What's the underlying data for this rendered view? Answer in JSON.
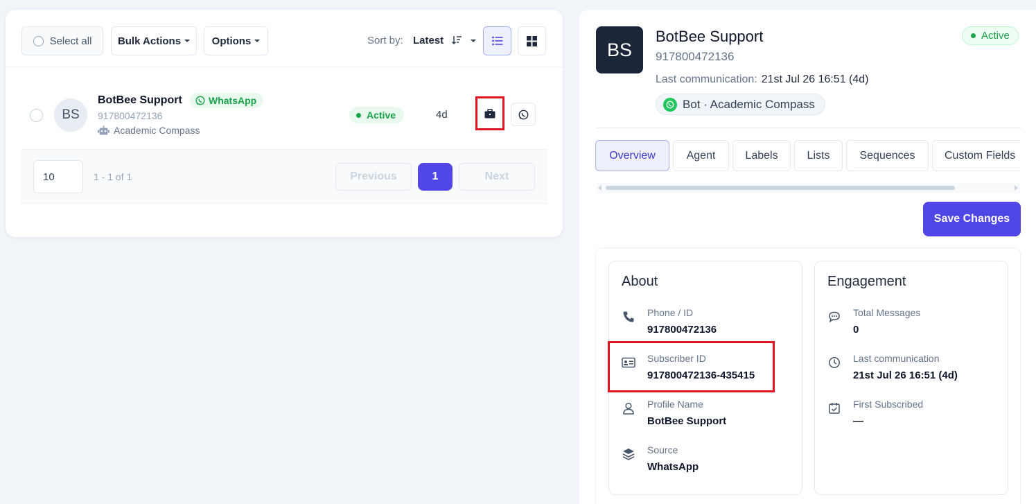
{
  "toolbar": {
    "select_all": "Select all",
    "bulk_actions": "Bulk Actions",
    "options": "Options",
    "sort_label": "Sort by:",
    "sort_value": "Latest"
  },
  "row": {
    "avatar_initials": "BS",
    "name": "BotBee Support",
    "channel": "WhatsApp",
    "phone": "917800472136",
    "bot": "Academic Compass",
    "status": "Active",
    "age": "4d"
  },
  "pagination": {
    "per_page": "10",
    "range": "1 - 1 of 1",
    "previous": "Previous",
    "current": "1",
    "next": "Next"
  },
  "contact": {
    "avatar_initials": "BS",
    "name": "BotBee Support",
    "phone": "917800472136",
    "last_comm_label": "Last communication:",
    "last_comm_value": "21st Jul 26 16:51 (4d)",
    "bot_pill": "Bot · Academic Compass",
    "status": "Active"
  },
  "tabs": [
    "Overview",
    "Agent",
    "Labels",
    "Lists",
    "Sequences",
    "Custom Fields"
  ],
  "save_label": "Save Changes",
  "about": {
    "title": "About",
    "fields": [
      {
        "label": "Phone / ID",
        "value": "917800472136",
        "icon": "phone-icon"
      },
      {
        "label": "Subscriber ID",
        "value": "917800472136-435415",
        "icon": "id-card-icon"
      },
      {
        "label": "Profile Name",
        "value": "BotBee Support",
        "icon": "user-icon"
      },
      {
        "label": "Source",
        "value": "WhatsApp",
        "icon": "layers-icon"
      }
    ]
  },
  "engagement": {
    "title": "Engagement",
    "fields": [
      {
        "label": "Total Messages",
        "value": "0",
        "icon": "chat-icon"
      },
      {
        "label": "Last communication",
        "value": "21st Jul 26 16:51 (4d)",
        "icon": "clock-icon"
      },
      {
        "label": "First Subscribed",
        "value": "—",
        "icon": "calendar-check-icon"
      }
    ]
  },
  "colors": {
    "accent": "#4f46e5",
    "active_green": "#16a34a",
    "highlight_red": "#e0141e"
  }
}
